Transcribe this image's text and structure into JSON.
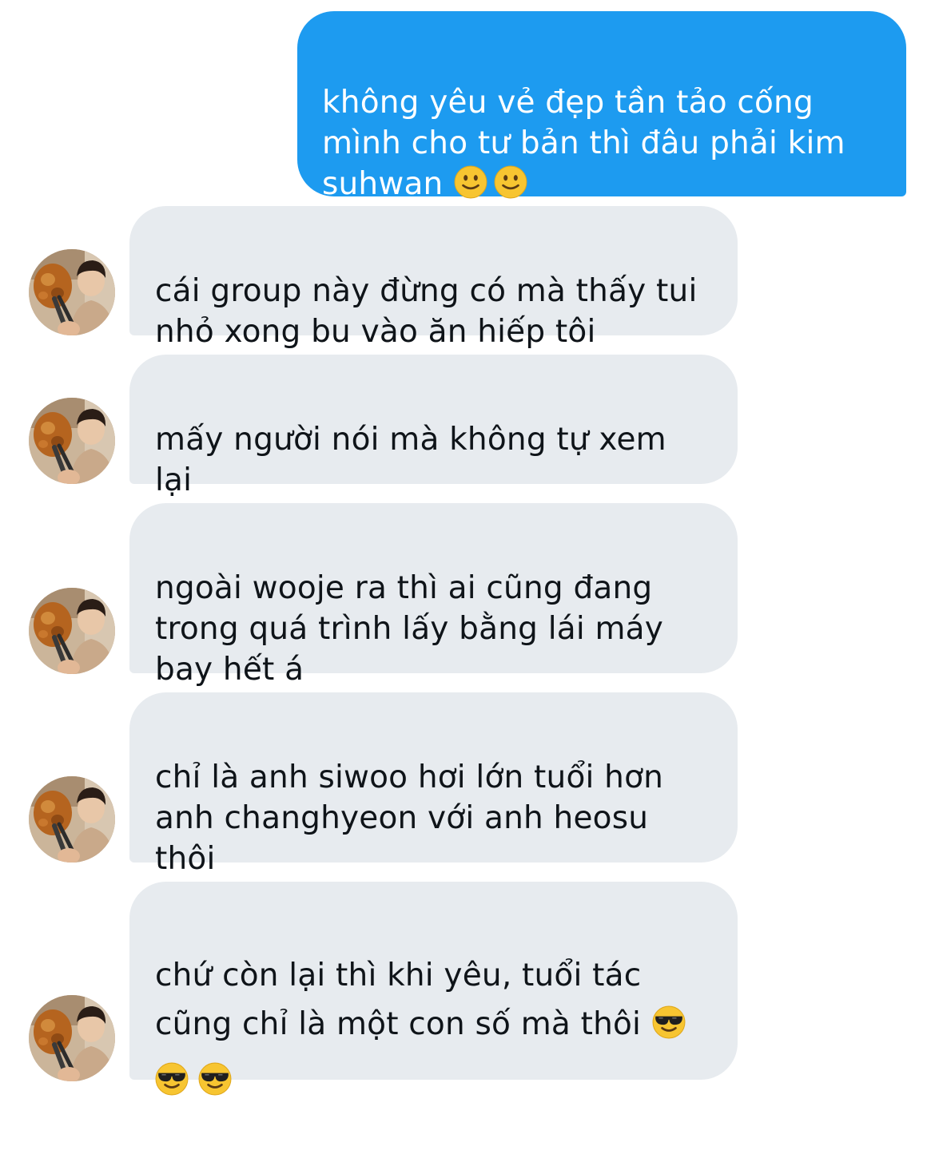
{
  "conversation": {
    "sent": [
      {
        "text": "không yêu vẻ đẹp tần tảo cống\nmình cho tư bản thì đâu phải kim\nsuhwan",
        "emojis": [
          "slightly-smiling-face-emoji",
          "slightly-smiling-face-emoji"
        ]
      }
    ],
    "received": [
      {
        "text": "cái group này đừng có mà thấy tui\nnhỏ xong bu vào ăn hiếp tôi"
      },
      {
        "text": "mấy người nói mà không tự xem lại\nbản thân hả?"
      },
      {
        "text": "ngoài wooje ra thì ai cũng đang\ntrong quá trình lấy bằng lái máy\nbay hết á"
      },
      {
        "text": "chỉ là anh siwoo hơi lớn tuổi hơn\nanh changhyeon với anh heosu thôi\nà"
      },
      {
        "text": "chứ còn lại thì khi yêu, tuổi tác\ncũng chỉ là một con số mà thôi",
        "emojis": [
          "sunglasses-face-emoji",
          "sunglasses-face-emoji",
          "sunglasses-face-emoji"
        ]
      }
    ]
  },
  "colors": {
    "sent_bubble": "#1d9bf0",
    "received_bubble": "#e7ebef",
    "sent_text": "#ffffff",
    "received_text": "#0f1419"
  }
}
